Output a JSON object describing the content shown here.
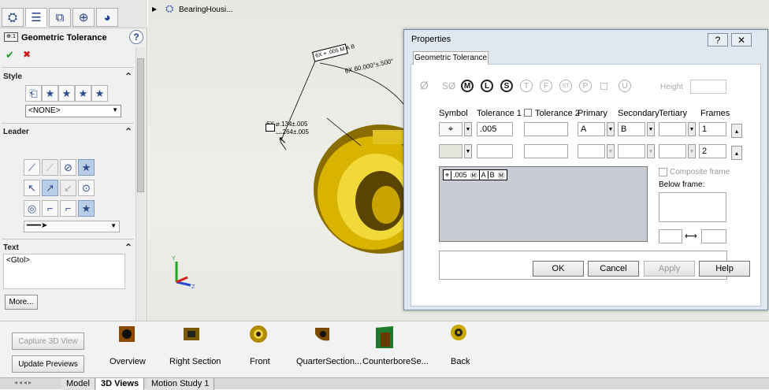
{
  "property_manager": {
    "tabs": [
      "feature-manager-icon",
      "property-manager-icon",
      "configuration-manager-icon",
      "dimxpert-icon",
      "display-manager-icon"
    ],
    "title": "Geometric Tolerance",
    "help": "?",
    "ok": "✔",
    "cancel": "✖",
    "style": {
      "header": "Style",
      "select_value": "<NONE>"
    },
    "leader": {
      "header": "Leader"
    },
    "text": {
      "header": "Text",
      "value": "<Gtol>",
      "more_button": "More..."
    }
  },
  "graphics": {
    "breadcrumb": "BearingHousi...",
    "callout_frame": {
      "prefix": "6X",
      "value": ".005",
      "mod": "M",
      "datum_a": "A",
      "datum_b": "B"
    },
    "angular_dim": "6X 60.000°±.500°",
    "hole_callout": {
      "line1_prefix": "6X",
      "line1": ".134±.005",
      "line2": ".264±.005"
    }
  },
  "dialog": {
    "title": "Properties",
    "help_btn": "?",
    "close_btn": "✕",
    "tab": "Geometric Tolerance",
    "symbols": [
      "Ø",
      "SØ",
      "M",
      "L",
      "S",
      "T",
      "F",
      "ST",
      "P",
      "□",
      "U"
    ],
    "height_label": "Height",
    "columns": {
      "symbol": "Symbol",
      "tol1": "Tolerance 1",
      "tol2": "Tolerance 2",
      "primary": "Primary",
      "secondary": "Secondary",
      "tertiary": "Tertiary",
      "frames": "Frames"
    },
    "row1": {
      "tol1": ".005",
      "primary": "A",
      "secondary": "B",
      "frame": "1"
    },
    "row2": {
      "frame": "2"
    },
    "preview": {
      "value": ".005",
      "mod": "M",
      "datum_a": "A",
      "datum_b": "B",
      "mod_b": "M"
    },
    "composite_frame": "Composite frame",
    "below_frame": "Below frame:",
    "buttons": {
      "ok": "OK",
      "cancel": "Cancel",
      "apply": "Apply",
      "help": "Help"
    }
  },
  "bottom": {
    "capture": "Capture 3D View",
    "update": "Update Previews",
    "views": [
      "Overview",
      "Right Section",
      "Front",
      "QuarterSection...",
      "CounterboreSe...",
      "Back"
    ],
    "tabs": [
      "Model",
      "3D Views",
      "Motion Study 1"
    ]
  },
  "colors": {
    "accent": "#24408c",
    "dialog_frame": "#dfe7f1",
    "part_gold": "#d6b400"
  }
}
